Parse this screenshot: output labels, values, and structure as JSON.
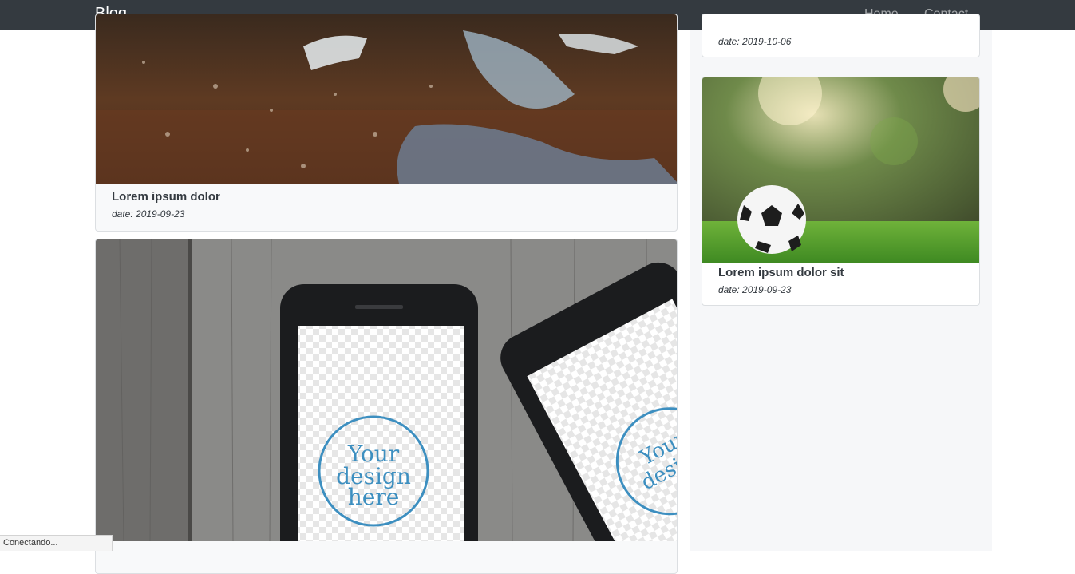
{
  "navbar": {
    "brand": "Blog",
    "links": [
      "Home",
      "Contact"
    ]
  },
  "posts": [
    {
      "title": "Lorem ipsum dolor",
      "date": "date: 2019-09-23",
      "image": "muddy-ground-photo"
    },
    {
      "title": "",
      "date": "",
      "image": "phone-mockup-photo",
      "mockup_text": [
        "Your",
        "design",
        "here"
      ]
    }
  ],
  "sidebar": {
    "cards": [
      {
        "title": "",
        "date": "date: 2019-10-06"
      },
      {
        "title": "Lorem ipsum dolor sit",
        "date": "date: 2019-09-23",
        "image": "soccer-ball-photo"
      }
    ]
  },
  "status_bar": {
    "text": "Conectando..."
  }
}
